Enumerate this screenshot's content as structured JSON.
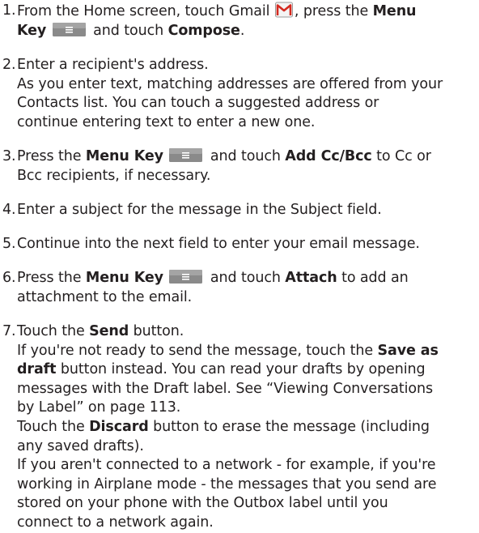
{
  "steps": [
    {
      "number": "1.",
      "lines": [
        {
          "t1": "From the Home screen, touch Gmail ",
          "icon1": "gmail-icon",
          "t2": ", press the ",
          "b1": "Menu"
        },
        {
          "b1": "Key",
          "t1": " ",
          "icon1": "menu-key-icon",
          "t2": " and touch ",
          "b2": "Compose",
          "t3": "."
        }
      ]
    },
    {
      "number": "2.",
      "lines": [
        {
          "t1": "Enter a recipient's address."
        },
        {
          "t1": "As you enter text, matching addresses are offered from your"
        },
        {
          "t1": "Contacts list. You can touch a suggested address or"
        },
        {
          "t1": "continue entering text to enter a new one."
        }
      ]
    },
    {
      "number": "3.",
      "lines": [
        {
          "t1": "Press the ",
          "b1": "Menu Key",
          "t2": " ",
          "icon1": "menu-key-icon",
          "t3": " and touch ",
          "b2": "Add Cc/Bcc",
          "t4": " to Cc or"
        },
        {
          "t1": "Bcc recipients, if necessary."
        }
      ]
    },
    {
      "number": "4.",
      "lines": [
        {
          "t1": "Enter a subject for the message in the Subject field."
        }
      ]
    },
    {
      "number": "5.",
      "lines": [
        {
          "t1": "Continue into the next field to enter your email message."
        }
      ]
    },
    {
      "number": "6.",
      "lines": [
        {
          "t1": "Press the ",
          "b1": "Menu Key",
          "t2": " ",
          "icon1": "menu-key-icon",
          "t3": " and touch ",
          "b2": "Attach",
          "t4": " to add an"
        },
        {
          "t1": "attachment to the email."
        }
      ]
    },
    {
      "number": "7.",
      "lines": [
        {
          "t1": "Touch the ",
          "b1": "Send",
          "t2": " button."
        },
        {
          "t1": "If you're not ready to send the message, touch the ",
          "b1": "Save as"
        },
        {
          "b1": "draft",
          "t1": " button instead. You can read your drafts by opening"
        },
        {
          "t1": "messages with the Draft label. See “Viewing Conversations"
        },
        {
          "t1": "by Label” on page 113."
        },
        {
          "t1": "Touch the ",
          "b1": "Discard",
          "t2": " button to erase the message (including"
        },
        {
          "t1": "any saved drafts)."
        },
        {
          "t1": "If you aren't connected to a network - for example, if you're"
        },
        {
          "t1": "working in Airplane mode - the messages that you send are"
        },
        {
          "t1": "stored on your phone with the Outbox label until you"
        },
        {
          "t1": "connect to a network again."
        }
      ]
    }
  ]
}
